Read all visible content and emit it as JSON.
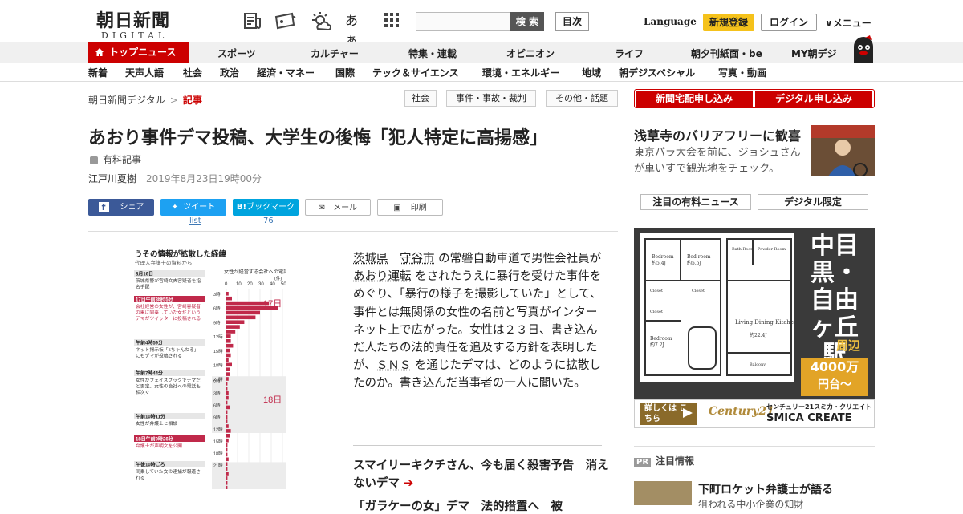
{
  "header": {
    "logo_main": "朝日新聞",
    "logo_sub": "DIGITAL",
    "icons": [
      "newspaper-icon",
      "coupon-icon",
      "weather-icon",
      "font-size-icon",
      "grid-icon"
    ],
    "font_label": "あぁ",
    "search_placeholder": "",
    "search_button": "検 索",
    "toc_button": "目次",
    "language": "Language",
    "register": "新規登録",
    "login": "ログイン",
    "menu": "∨メニュー"
  },
  "nav_primary": {
    "active": "トップニュース",
    "items": [
      "スポーツ",
      "カルチャー",
      "特集・連載",
      "オピニオン",
      "ライフ",
      "朝夕刊紙面・be",
      "MY朝デジ"
    ]
  },
  "nav_secondary": {
    "items": [
      "新着",
      "天声人語",
      "社会",
      "政治",
      "経済・マネー",
      "国際",
      "テック＆サイエンス",
      "環境・エネルギー",
      "地域",
      "朝デジスペシャル",
      "写真・動画"
    ]
  },
  "breadcrumb": {
    "root": "朝日新聞デジタル",
    "sep": ">",
    "current": "記事"
  },
  "tags": [
    "社会",
    "事件・事故・裁判",
    "その他・話題"
  ],
  "subscribe": {
    "paper": "新聞宅配申し込み",
    "digital": "デジタル申し込み"
  },
  "article": {
    "title": "あおり事件デマ投稿、大学生の後悔「犯人特定に高揚感」",
    "paid_label": "有料記事",
    "author": "江戸川夏樹",
    "date": "2019年8月23日19時00分",
    "share": {
      "facebook": "シェア",
      "twitter": "ツイート",
      "twitter_count": "list",
      "hatena": "ブックマーク",
      "hatena_count": "76",
      "mail": "メール",
      "print": "印刷"
    },
    "body_parts": {
      "p1": "茨城県",
      "p2": "守谷市",
      "p3": "の常磐自動車道で男性会社員が",
      "p4": "あおり運転",
      "p5": "をされたうえに暴行を受けた事件をめぐり、「暴行の様子を撮影していた」として、事件とは無関係の女性の名前と写真がインターネット上で広がった。女性は２３日、書き込んだ人たちの法的責任を追及する方針を表明したが、",
      "p6": "ＳＮＳ",
      "p7": "を通じたデマは、どのように拡散したのか。書き込んだ当事者の一人に聞いた。"
    },
    "related1": "スマイリーキクチさん、今も届く殺害予告　消えないデマ",
    "related2": "「ガラケーの女」デマ　法的措置へ　被"
  },
  "figure": {
    "title": "うその情報が拡散した経緯",
    "source": "代理人弁護士の資料から",
    "chart_header": "女性が経営する会社への電話着信件数",
    "unit": "(件)",
    "ticks": [
      "0",
      "10",
      "20",
      "30",
      "40",
      "50"
    ],
    "day17": "17日",
    "day18": "18日",
    "events": [
      {
        "t": "8月16日",
        "d": "茨城県警が宮崎文夫容疑者を指名手配",
        "hl": false
      },
      {
        "t": "17日午前3時55分",
        "d": "会社経営の女性が、宮崎容疑者の車に同乗していた女だというデマがツイッターに投稿される",
        "hl": true
      },
      {
        "t": "午前4時59分",
        "d": "ネット掲示板「5ちゃんねる」にもデマが投稿される",
        "hl": false
      },
      {
        "t": "午前7時44分",
        "d": "女性がフェイスブックでデマだと否定。女性の会社への電話も相次ぐ",
        "hl": false
      },
      {
        "t": "午前10時11分",
        "d": "女性が弁護士と相談",
        "hl": false
      },
      {
        "t": "18日午前0時26分",
        "d": "弁護士が声明文を公開",
        "hl": true
      },
      {
        "t": "午後10時ごろ",
        "d": "同乗していた女の逮捕が報道される",
        "hl": false
      }
    ],
    "hours17": [
      "3時",
      "6時",
      "9時",
      "12時",
      "15時",
      "18時",
      "21時"
    ],
    "hours18": [
      "0時",
      "3時",
      "6時",
      "9時",
      "12時",
      "15時",
      "18時",
      "21時"
    ]
  },
  "chart_data": {
    "type": "bar",
    "title": "女性が経営する会社への電話着信件数",
    "ylabel": "(件)",
    "xlim": [
      0,
      50
    ],
    "series": [
      {
        "values": [
          2,
          5,
          38,
          46,
          30,
          26,
          16,
          12,
          8,
          4,
          4,
          6,
          3,
          4,
          2,
          5,
          3,
          3,
          2,
          1,
          1,
          2,
          2,
          1,
          3,
          1,
          1,
          1,
          2,
          4,
          3,
          2,
          1,
          1,
          1,
          2,
          1,
          1,
          2,
          1,
          1,
          1
        ]
      }
    ]
  },
  "sidebar": {
    "feature_title": "浅草寺のバリアフリーに歓喜",
    "feature_desc": "東京パラ大会を前に、ジョシュさんが車いすで観光地をチェック。",
    "tab1": "注目の有料ニュース",
    "tab2": "デジタル限定",
    "ad": {
      "big1": "中目黒・",
      "big2": "自由ヶ丘駅",
      "area": "周辺",
      "price1": "4000万",
      "price2": "円台〜",
      "cta": "詳しくは こちら",
      "brand": "Century21",
      "company_small": "センチュリー21スミカ・クリエイト",
      "company": "SMICA CREATE",
      "rooms": [
        "Bedroom",
        "Bed room",
        "Bath Room",
        "Powder Room",
        "Closet",
        "Closet",
        "Closet",
        "Bedroom",
        "Living Dining Kitchen",
        "Balcony"
      ],
      "sizes": [
        "約5.4J",
        "約5.5J",
        "約7.2J",
        "約22.4J"
      ]
    },
    "pr_badge": "PR",
    "pr_label": "注目情報",
    "pr_title": "下町ロケット弁護士が語る",
    "pr_sub": "狙われる中小企業の知財"
  },
  "colors": {
    "brand_red": "#cc0000",
    "figure_red": "#c0294a",
    "register_yellow": "#f5c21b",
    "facebook": "#3b5998",
    "twitter": "#1da1f2",
    "hatena": "#00a4de"
  }
}
